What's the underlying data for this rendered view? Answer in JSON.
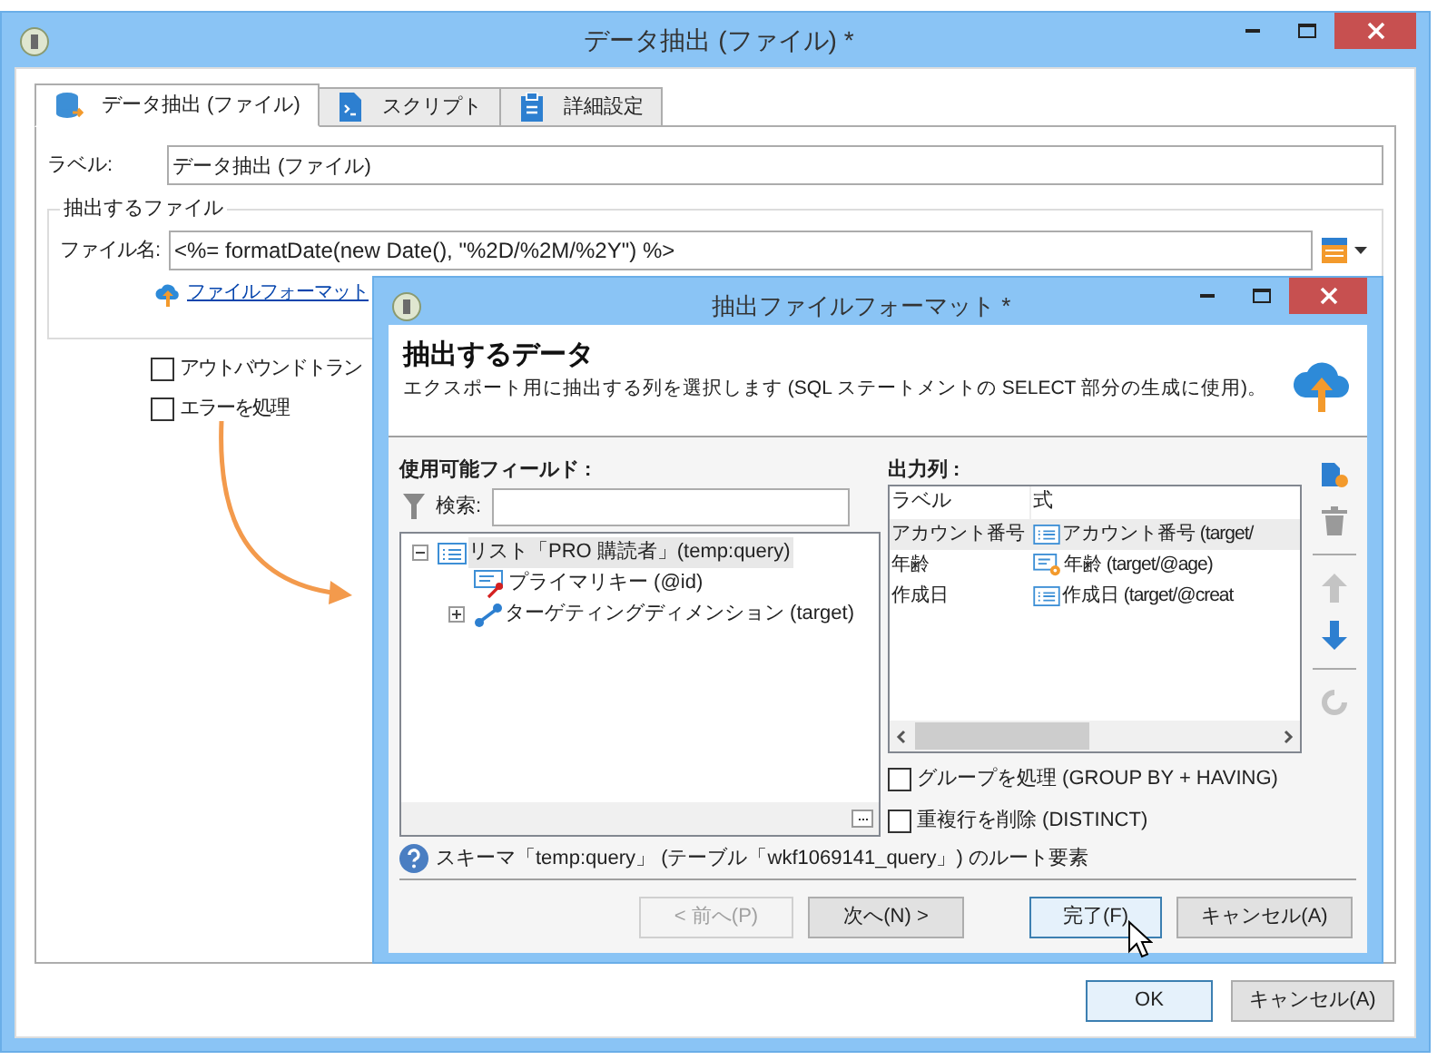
{
  "window": {
    "title": "データ抽出 (ファイル) *"
  },
  "tabs": [
    {
      "label": "データ抽出 (ファイル)",
      "selected": true
    },
    {
      "label": "スクリプト",
      "selected": false
    },
    {
      "label": "詳細設定",
      "selected": false
    }
  ],
  "label_field": {
    "label": "ラベル:",
    "value": "データ抽出 (ファイル)"
  },
  "file_group": {
    "title": "抽出するファイル",
    "filename_label": "ファイル名:",
    "filename_value": "<%= formatDate(new Date(), \"%2D/%2M/%2Y\") %>",
    "link": "ファイルフォーマット"
  },
  "options": [
    {
      "label": "アウトバウンドトラン",
      "checked": false
    },
    {
      "label": "エラーを処理",
      "checked": false
    }
  ],
  "buttons": [
    {
      "label": "OK",
      "focused": true
    },
    {
      "label": "キャンセル(A)",
      "focused": false
    }
  ],
  "dialog": {
    "title": "抽出ファイルフォーマット *",
    "heading": "抽出するデータ",
    "description": "エクスポート用に抽出する列を選択します (SQL ステートメントの SELECT 部分の生成に使用)。",
    "fields_label": "使用可能フィールド :",
    "search_label": "検索:",
    "tree": [
      {
        "label": "リスト「PRO 購読者」(temp:query)",
        "kind": "list",
        "expanded": true,
        "selected": true,
        "children": [
          {
            "label": "プライマリキー (@id)",
            "kind": "key",
            "selected": false
          },
          {
            "label": "ターゲティングディメンション (target)",
            "kind": "link",
            "expanded": false,
            "selected": false
          }
        ]
      }
    ],
    "output_label": "出力列 :",
    "columns": [
      "ラベル",
      "式"
    ],
    "rows": [
      {
        "label": "アカウント番号",
        "expression": "アカウント番号 (target/",
        "kind": "field",
        "selected": true
      },
      {
        "label": "年齢",
        "expression": "年齢 (target/@age)",
        "kind": "computed",
        "selected": false
      },
      {
        "label": "作成日",
        "expression": "作成日 (target/@creat",
        "kind": "field",
        "selected": false
      }
    ],
    "toolbar": [
      {
        "kind": "add",
        "disabled": false
      },
      {
        "kind": "delete",
        "disabled": true
      },
      {
        "kind": "up",
        "disabled": true
      },
      {
        "kind": "down",
        "disabled": false
      },
      {
        "kind": "refresh",
        "disabled": true
      }
    ],
    "checks": [
      {
        "label": "グループを処理 (GROUP BY + HAVING)",
        "checked": false
      },
      {
        "label": "重複行を削除 (DISTINCT)",
        "checked": false
      }
    ],
    "help": "スキーマ「temp:query」 (テーブル「wkf1069141_query」) のルート要素",
    "buttons": [
      {
        "label": "< 前へ(P)",
        "disabled": true,
        "focused": false
      },
      {
        "label": "次へ(N) >",
        "disabled": false,
        "focused": false
      },
      {
        "label": "完了(F)",
        "disabled": false,
        "focused": true
      },
      {
        "label": "キャンセル(A)",
        "disabled": false,
        "focused": false
      }
    ]
  }
}
